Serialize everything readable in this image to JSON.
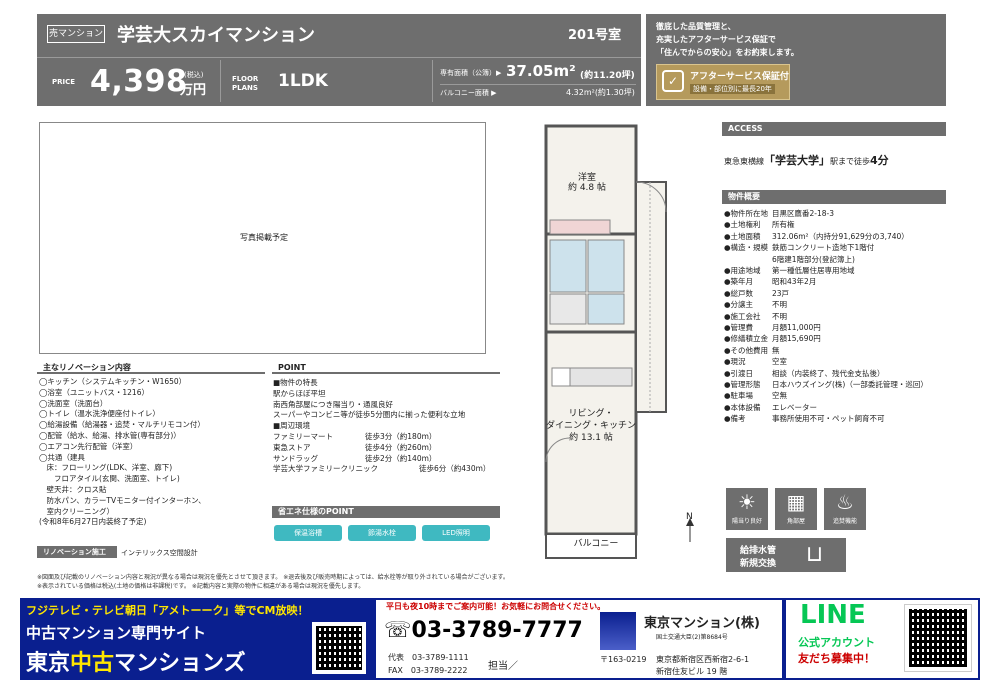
{
  "header": {
    "tag": "売マンション",
    "name": "学芸大スカイマンション",
    "room": "201号室",
    "price_label": "PRICE",
    "price": "4,398",
    "price_tax": "(税込)",
    "price_unit": "万円",
    "floor_label_1": "FLOOR",
    "floor_label_2": "PLANS",
    "floor_plan": "1LDK",
    "area_label": "専有面積（公簿）▶",
    "area_value": "37.05m²",
    "area_tsubo": "(約11.20坪)",
    "balcony_label": "バルコニー面積 ▶",
    "balcony_value": "4.32m²(約1.30坪)"
  },
  "promo": {
    "line1": "徹底した品質管理と、",
    "line2": "充実したアフターサービス保証で",
    "line3": "「住んでからの安心」をお約束します。",
    "badge_title": "アフターサービス保証付",
    "badge_sub": "設備・部位別に最長20年"
  },
  "photo_placeholder": "写真掲載予定",
  "renovation": {
    "title": "主なリノベーション内容",
    "items": [
      "◯キッチン（システムキッチン・W1650）",
      "◯浴室（ユニットバス・1216）",
      "◯洗面室（洗面台）",
      "◯トイレ（温水洗浄便座付トイレ）",
      "◯給湯設備（給湯器・追焚・マルチリモコン付）",
      "◯配管（給水、給湯、排水管(専有部分)）",
      "◯エアコン先行配管（洋室）",
      "◯共通（建具",
      "　床：フローリング(LDK、洋室、廊下)",
      "　　フロアタイル(玄関、洗面室、トイレ)",
      "　壁天井：クロス貼",
      "　防水パン、カラーTVモニター付インターホン、",
      "　室内クリーニング）",
      "(令和8年6月27日内装終了予定)"
    ],
    "builder_label": "リノベーション施工",
    "builder_name": "インテリックス空間設計"
  },
  "point": {
    "title": "POINT",
    "features_head": "■物件の特長",
    "features": [
      "駅からほぼ平坦",
      "南西角部屋につき陽当り・通風良好",
      "スーパーやコンビニ等が徒歩5分圏内に揃った便利な立地"
    ],
    "env_head": "■周辺環境",
    "env": [
      {
        "name": "ファミリーマート",
        "dist": "徒歩3分（約180m）"
      },
      {
        "name": "東急ストア",
        "dist": "徒歩4分（約260m）"
      },
      {
        "name": "サンドラッグ",
        "dist": "徒歩2分（約140m）"
      },
      {
        "name": "学芸大学ファミリークリニック",
        "dist": "徒歩6分（約430m）"
      }
    ]
  },
  "eco": {
    "title": "省エネ仕様のPOINT",
    "pills": [
      "保温浴槽",
      "節湯水栓",
      "LED照明"
    ]
  },
  "access": {
    "title": "ACCESS",
    "line": "東急東横線",
    "station": "「学芸大学」",
    "walk": "駅まで徒歩",
    "minutes": "4分"
  },
  "overview": {
    "title": "物件概要",
    "rows": [
      {
        "k": "●物件所在地",
        "v": "目黒区鷹番2-18-3"
      },
      {
        "k": "●土地権利",
        "v": "所有権"
      },
      {
        "k": "●土地面積",
        "v": "312.06m²（内持分91,629分の3,740）"
      },
      {
        "k": "●構造・規模",
        "v": "鉄筋コンクリート造地下1階付"
      },
      {
        "k": "",
        "v": "6階建1階部分(登記簿上)"
      },
      {
        "k": "●用途地域",
        "v": "第一種低層住居専用地域"
      },
      {
        "k": "●築年月",
        "v": "昭和43年2月"
      },
      {
        "k": "●総戸数",
        "v": "23戸"
      },
      {
        "k": "●分譲主",
        "v": "不明"
      },
      {
        "k": "●施工会社",
        "v": "不明"
      },
      {
        "k": "●管理費",
        "v": "月額11,000円"
      },
      {
        "k": "●修繕積立金",
        "v": "月額15,690円"
      },
      {
        "k": "●その他費用",
        "v": "無"
      },
      {
        "k": "●現況",
        "v": "空室"
      },
      {
        "k": "●引渡日",
        "v": "相談（内装終了、残代金支払後）"
      },
      {
        "k": "●管理形態",
        "v": "日本ハウズイング(株)（一部委託管理・巡回）"
      },
      {
        "k": "●駐車場",
        "v": "空無"
      },
      {
        "k": "●本体設備",
        "v": "エレベーター"
      },
      {
        "k": "●備考",
        "v": "事務所使用不可・ペット飼育不可"
      }
    ]
  },
  "icons": {
    "sun": "陽当り良好",
    "corner": "角部屋",
    "bath": "追焚機能",
    "pipe_1": "給排水管",
    "pipe_2": "新規交換"
  },
  "plan": {
    "room1": "洋室",
    "room1_size": "約 4.8 帖",
    "ldk1": "リビング・",
    "ldk2": "ダイニング・キッチン",
    "ldk_size": "約 13.1 帖",
    "balcony": "バルコニー",
    "north": "N"
  },
  "notes": [
    "※図面及び記載のリノベーション内容と現況が異なる場合は現況を優先とさせて頂きます。 ※退去後及び販売時期によっては、給水栓等が取り外されている場合がございます。",
    "※表示されている価格は税込(土地の価格は非課税)です。 ※記載内容と実際の物件に相違がある場合は現況を優先します。"
  ],
  "footer": {
    "tv": "フジテレビ・テレビ朝日「アメトーーク」等でCM放映！",
    "site1": "中古マンション専門サイト",
    "site2a": "東京",
    "site2b": "中古",
    "site2c": "マンションズ",
    "hours": "平日も夜10時までご案内可能！お気軽にお問合せください。",
    "tel": "03-3789-7777",
    "rep_label": "代表",
    "rep_tel": "03-3789-1111",
    "fax_label": "FAX",
    "fax_tel": "03-3789-2222",
    "charge": "担当／",
    "company": "東京マンション(株)",
    "license": "国土交通大臣(2)第8684号",
    "zip": "〒163-0219",
    "addr1": "東京都新宿区西新宿2-6-1",
    "addr2": "新宿住友ビル 19 階",
    "line_title": "LINE",
    "line_sub1": "公式アカウント",
    "line_sub2": "友だち募集中！"
  },
  "colors": {
    "header_gray": "#6e6e6e",
    "accent_teal": "#3fb9c1",
    "footer_blue": "#0a1f8f",
    "line_green": "#06c755",
    "badge_gold": "#b59a5c"
  }
}
